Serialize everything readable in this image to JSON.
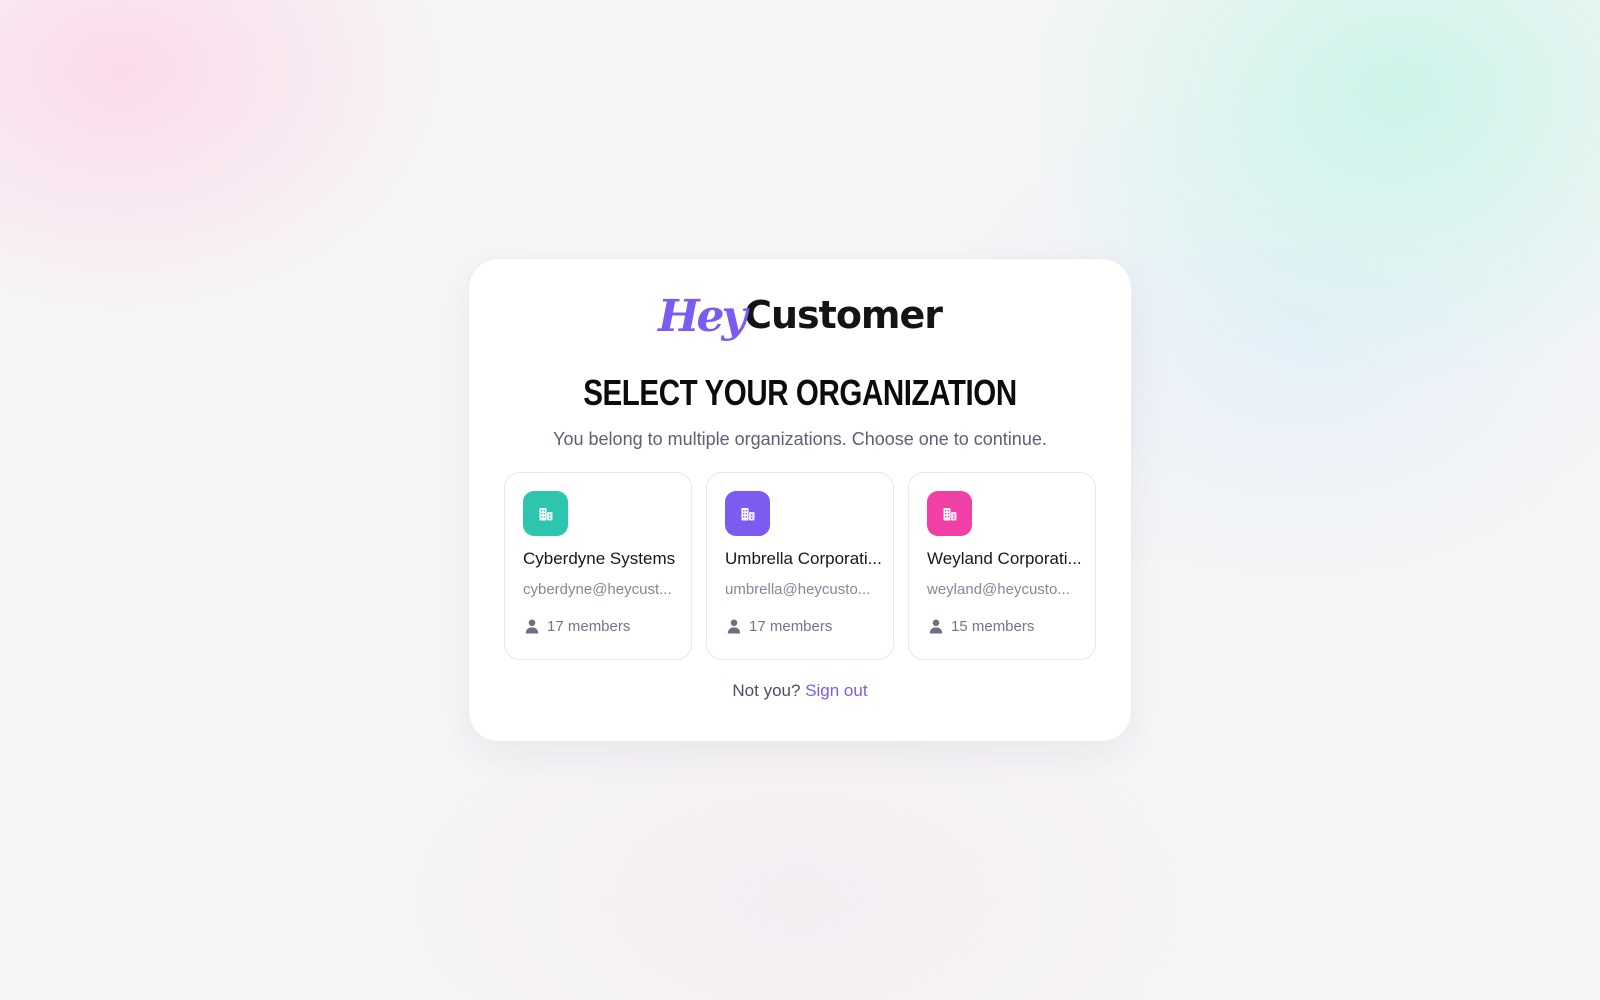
{
  "brand": {
    "logo_prefix": "Hey",
    "logo_suffix": "Customer",
    "accent_color": "#7c5cf0"
  },
  "page": {
    "title": "SELECT YOUR ORGANIZATION",
    "subtitle": "You belong to multiple organizations. Choose one to continue."
  },
  "organizations": [
    {
      "name": "Cyberdyne Systems",
      "email": "cyberdyne@heycust...",
      "members": "17 members",
      "icon": "building-icon",
      "color": "#2dc5ad"
    },
    {
      "name": "Umbrella Corporati...",
      "email": "umbrella@heycusto...",
      "members": "17 members",
      "icon": "building-icon",
      "color": "#7c5cf0"
    },
    {
      "name": "Weyland Corporati...",
      "email": "weyland@heycusto...",
      "members": "15 members",
      "icon": "building-icon",
      "color": "#f03fa5"
    }
  ],
  "footer": {
    "prompt": "Not you?",
    "signout_label": "Sign out"
  }
}
